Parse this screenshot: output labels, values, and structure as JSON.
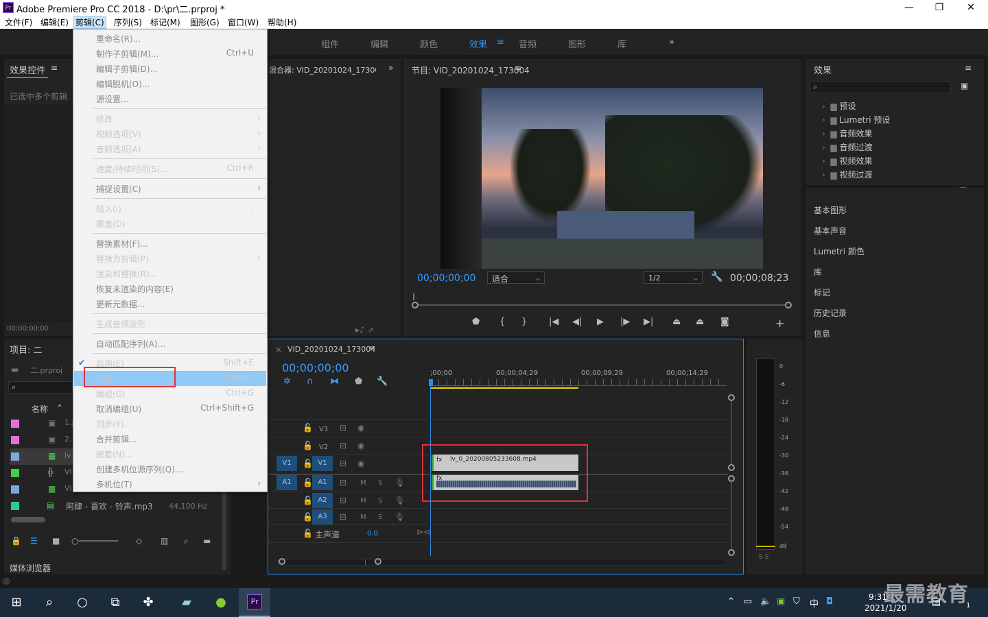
{
  "window": {
    "title": "Adobe Premiere Pro CC 2018 - D:\\pr\\二.prproj *",
    "app_icon": "Pr",
    "min": "—",
    "max": "❐",
    "close": "✕"
  },
  "menu": [
    "文件(F)",
    "编辑(E)",
    "剪辑(C)",
    "序列(S)",
    "标记(M)",
    "图形(G)",
    "窗口(W)",
    "帮助(H)"
  ],
  "workspaces": [
    "组件",
    "编辑",
    "颜色",
    "效果",
    "音频",
    "图形",
    "库"
  ],
  "workspace_active": "效果",
  "workspace_more": "»",
  "effects_controls": {
    "title": "效果控件",
    "subtitle": "已选中多个剪辑",
    "timecode": "00;00;00;00"
  },
  "audio_mixer": {
    "title": "混合器: VID_20201024_17300"
  },
  "program": {
    "title": "节目: VID_20201024_173004",
    "timecode": "00;00;00;00",
    "fit": "适合",
    "res": "1/2",
    "duration": "00;00;08;23"
  },
  "project": {
    "title": "项目: 二",
    "file": "二.prproj",
    "col_name": "名称",
    "rows": [
      "1.j",
      "2.",
      "lv",
      "VI",
      "VI"
    ],
    "audio_file": "阿肆 - 喜欢 - 铃声.mp3",
    "audio_rate": "44,100 Hz"
  },
  "media_browser": "媒体浏览器",
  "effects": {
    "title": "效果",
    "items": [
      "预设",
      "Lumetri 预设",
      "音频效果",
      "音频过渡",
      "视频效果",
      "视频过渡"
    ],
    "panels": [
      "基本图形",
      "基本声音",
      "Lumetri 颜色",
      "库",
      "标记",
      "历史记录",
      "信息"
    ]
  },
  "timeline": {
    "title": "VID_20201024_173004",
    "timecode": "00;00;00;00",
    "ruler": [
      ";00;00",
      "00;00;04;29",
      "00;00;09;29",
      "00;00;14;29"
    ],
    "tracks_v": [
      "V3",
      "V2",
      "V1"
    ],
    "tracks_a": [
      "A1",
      "A2",
      "A3"
    ],
    "master": "主声道",
    "master_val": "0.0",
    "clip_name": "lv_0_20200805233608.mp4",
    "src_v": "V1",
    "src_a": "A1",
    "m": "M",
    "s": "S"
  },
  "meter": {
    "ticks": [
      "0",
      "-6",
      "-12",
      "-18",
      "-24",
      "-30",
      "-36",
      "-42",
      "-48",
      "-54",
      "dB"
    ],
    "ss": "S S"
  },
  "dropdown": [
    {
      "label": "重命名(R)...",
      "shortcut": "",
      "dis": true
    },
    {
      "label": "制作子剪辑(M)...",
      "shortcut": "Ctrl+U",
      "dis": true
    },
    {
      "label": "编辑子剪辑(D)...",
      "shortcut": "",
      "dis": true
    },
    {
      "label": "编辑脱机(O)...",
      "shortcut": "",
      "dis": true
    },
    {
      "label": "源设置...",
      "shortcut": "",
      "dis": true
    },
    {
      "label": "修改",
      "shortcut": "",
      "dis": false,
      "arrow": true
    },
    {
      "label": "视频选项(V)",
      "shortcut": "",
      "dis": false,
      "arrow": true
    },
    {
      "label": "音频选项(A)",
      "shortcut": "",
      "dis": false,
      "arrow": true
    },
    {
      "label": "速度/持续时间(S)...",
      "shortcut": "Ctrl+R",
      "dis": false
    },
    {
      "label": "捕捉设置(C)",
      "shortcut": "",
      "dis": true,
      "arrow": true
    },
    {
      "label": "插入(I)",
      "shortcut": ",",
      "dis": false
    },
    {
      "label": "覆盖(O)",
      "shortcut": ".",
      "dis": false
    },
    {
      "label": "替换素材(F)...",
      "shortcut": "",
      "dis": true
    },
    {
      "label": "替换为剪辑(P)",
      "shortcut": "",
      "dis": false,
      "arrow": true
    },
    {
      "label": "渲染和替换(R)...",
      "shortcut": "",
      "dis": false
    },
    {
      "label": "恢复未渲染的内容(E)",
      "shortcut": "",
      "dis": true
    },
    {
      "label": "更新元数据...",
      "shortcut": "",
      "dis": true
    },
    {
      "label": "生成音频波形",
      "shortcut": "",
      "dis": false
    },
    {
      "label": "自动匹配序列(A)...",
      "shortcut": "",
      "dis": true
    },
    {
      "label": "启用(E)",
      "shortcut": "Shift+E",
      "dis": false,
      "check": true
    },
    {
      "label": "链接",
      "shortcut": "Ctrl+L",
      "dis": false
    },
    {
      "label": "编组(G)",
      "shortcut": "Ctrl+G",
      "dis": false
    },
    {
      "label": "取消编组(U)",
      "shortcut": "Ctrl+Shift+G",
      "dis": true
    },
    {
      "label": "同步(Y)...",
      "shortcut": "",
      "dis": false
    },
    {
      "label": "合并剪辑...",
      "shortcut": "",
      "dis": true
    },
    {
      "label": "嵌套(N)...",
      "shortcut": "",
      "dis": false
    },
    {
      "label": "创建多机位源序列(Q)...",
      "shortcut": "",
      "dis": true
    },
    {
      "label": "多机位(T)",
      "shortcut": "",
      "dis": true,
      "arrow": true
    }
  ],
  "taskbar": {
    "time": "9:31",
    "date": "2021/1/20",
    "ime": "中",
    "badge": "1"
  },
  "watermark": "最需教育",
  "colors": {
    "accent": "#2d8ceb",
    "highlight": "#91c9f7",
    "red": "#e0333a"
  }
}
